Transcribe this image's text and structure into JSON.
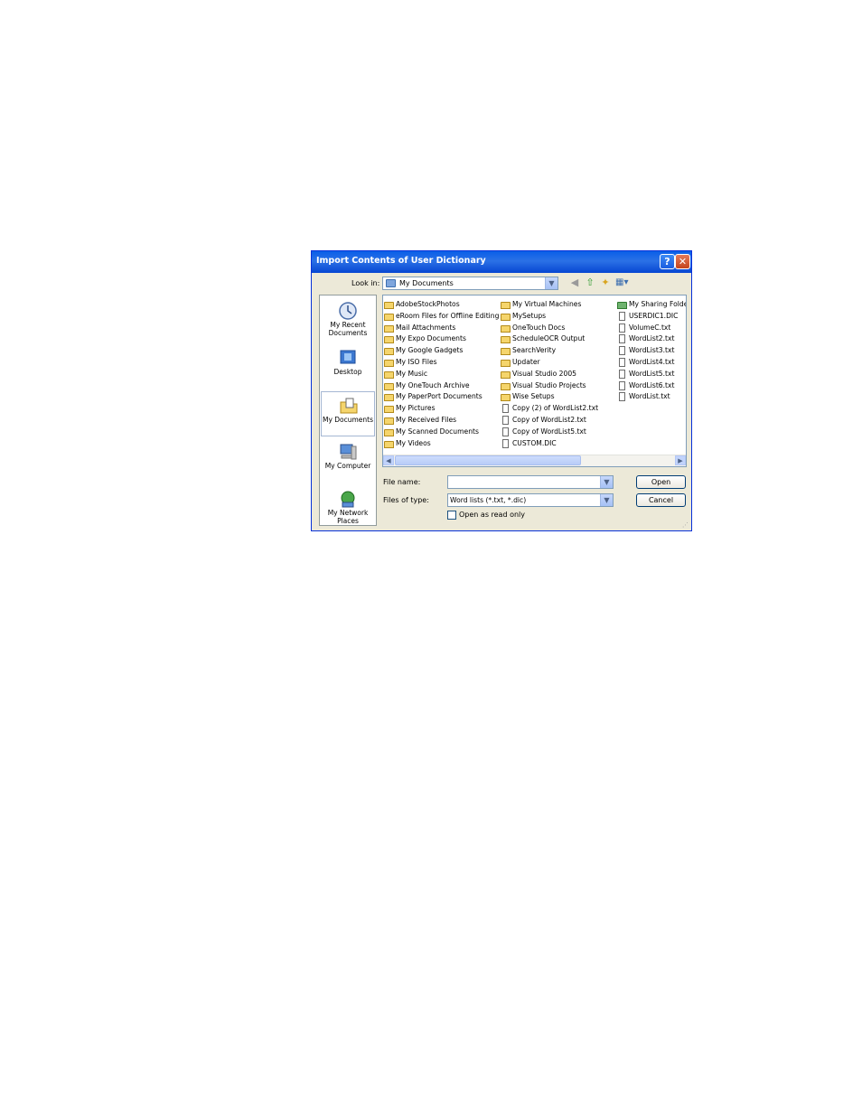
{
  "dialog": {
    "title": "Import Contents of User Dictionary",
    "help_label": "?",
    "close_label": "✕",
    "look_in_label": "Look in:",
    "look_in_value": "My Documents",
    "places": [
      {
        "label": "My Recent Documents"
      },
      {
        "label": "Desktop"
      },
      {
        "label": "My Documents"
      },
      {
        "label": "My Computer"
      },
      {
        "label": "My Network Places"
      }
    ],
    "files": {
      "col1": [
        "AdobeStockPhotos",
        "eRoom Files for Offline Editing",
        "Mail Attachments",
        "My Expo Documents",
        "My Google Gadgets",
        "My ISO Files",
        "My Music",
        "My OneTouch Archive",
        "My PaperPort Documents",
        "My Pictures",
        "My Received Files",
        "My Scanned Documents",
        "My Videos"
      ],
      "col2": [
        "My Virtual Machines",
        "MySetups",
        "OneTouch Docs",
        "ScheduleOCR Output",
        "SearchVerity",
        "Updater",
        "Visual Studio 2005",
        "Visual Studio Projects",
        "Wise Setups",
        "Copy (2) of WordList2.txt",
        "Copy of WordList2.txt",
        "Copy of WordList5.txt",
        "CUSTOM.DIC"
      ],
      "col3": [
        "My Sharing Folders",
        "USERDIC1.DIC",
        "VolumeC.txt",
        "WordList2.txt",
        "WordList3.txt",
        "WordList4.txt",
        "WordList5.txt",
        "WordList6.txt",
        "WordList.txt"
      ]
    },
    "file_name_label": "File name:",
    "file_name_value": "",
    "files_of_type_label": "Files of type:",
    "files_of_type_value": "Word lists (*.txt, *.dic)",
    "open_label": "Open",
    "cancel_label": "Cancel",
    "read_only_label": "Open as read only"
  }
}
